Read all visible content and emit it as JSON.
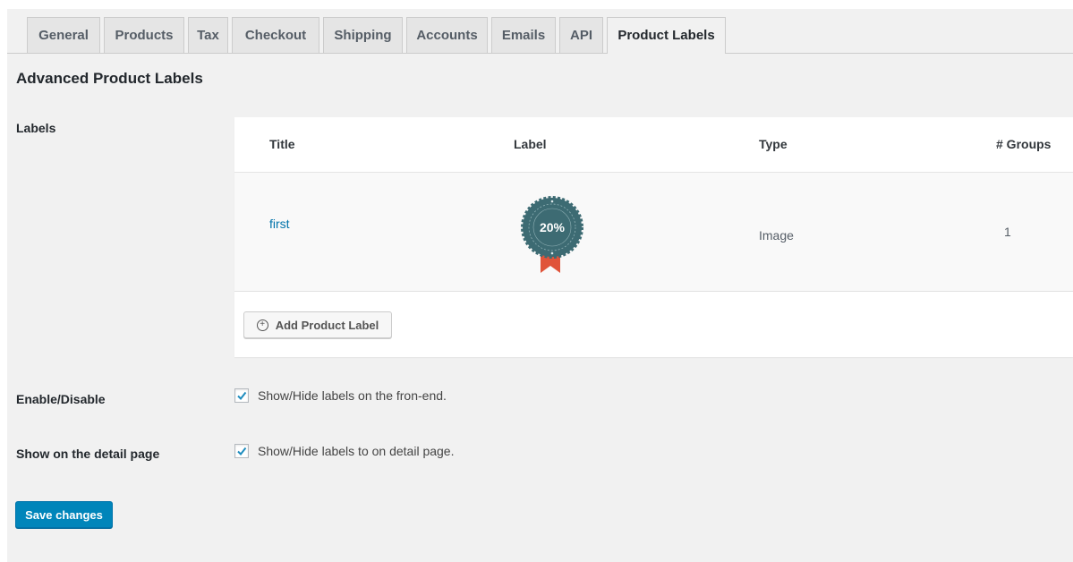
{
  "tabs": [
    {
      "label": "General"
    },
    {
      "label": "Products"
    },
    {
      "label": "Tax"
    },
    {
      "label": "Checkout"
    },
    {
      "label": "Shipping"
    },
    {
      "label": "Accounts"
    },
    {
      "label": "Emails"
    },
    {
      "label": "API"
    },
    {
      "label": "Product Labels",
      "active": true
    }
  ],
  "section_title": "Advanced Product Labels",
  "labels_section": {
    "row_label": "Labels",
    "columns": [
      "Title",
      "Label",
      "Type",
      "# Groups"
    ],
    "rows": [
      {
        "title": "first",
        "badge_text": "20%",
        "type": "Image",
        "groups": "1"
      }
    ],
    "add_button": "Add Product Label"
  },
  "enable": {
    "row_label": "Enable/Disable",
    "checkbox_label": "Show/Hide labels on the fron-end.",
    "checked": true
  },
  "detail": {
    "row_label": "Show on the detail page",
    "checkbox_label": "Show/Hide labels to on detail page.",
    "checked": true
  },
  "save_button": "Save changes",
  "colors": {
    "accent": "#0085ba",
    "badge_teal": "#3d6b73",
    "ribbon": "#e0543a",
    "link": "#0073aa"
  }
}
